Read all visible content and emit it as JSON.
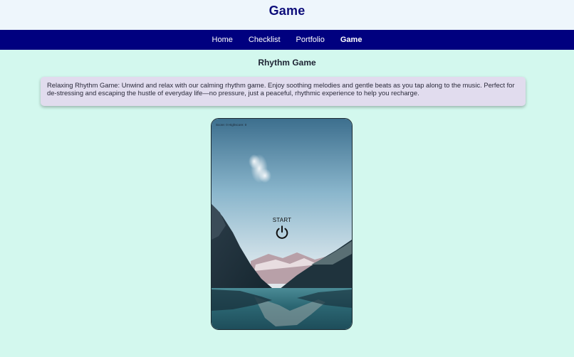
{
  "header": {
    "title": "Game"
  },
  "nav": {
    "items": [
      {
        "label": "Home"
      },
      {
        "label": "Checklist"
      },
      {
        "label": "Portfolio"
      },
      {
        "label": "Game"
      }
    ]
  },
  "main": {
    "section_title": "Rhythm Game",
    "description": "Relaxing Rhythm Game: Unwind and relax with our calming rhythm game. Enjoy soothing melodies and gentle beats as you tap along to the music. Perfect for de-stressing and escaping the hustle of everyday life—no pressure, just a peaceful, rhythmic experience to help you recharge."
  },
  "game": {
    "score_text": "Score: 0  Highscore: 0",
    "start_label": "START",
    "start_icon": "power-icon"
  },
  "colors": {
    "page_background": "#d3f8ee",
    "header_background": "#eef6fc",
    "nav_background": "#00007f",
    "title_color": "#0d0d7a",
    "description_background": "#e1dcee"
  }
}
